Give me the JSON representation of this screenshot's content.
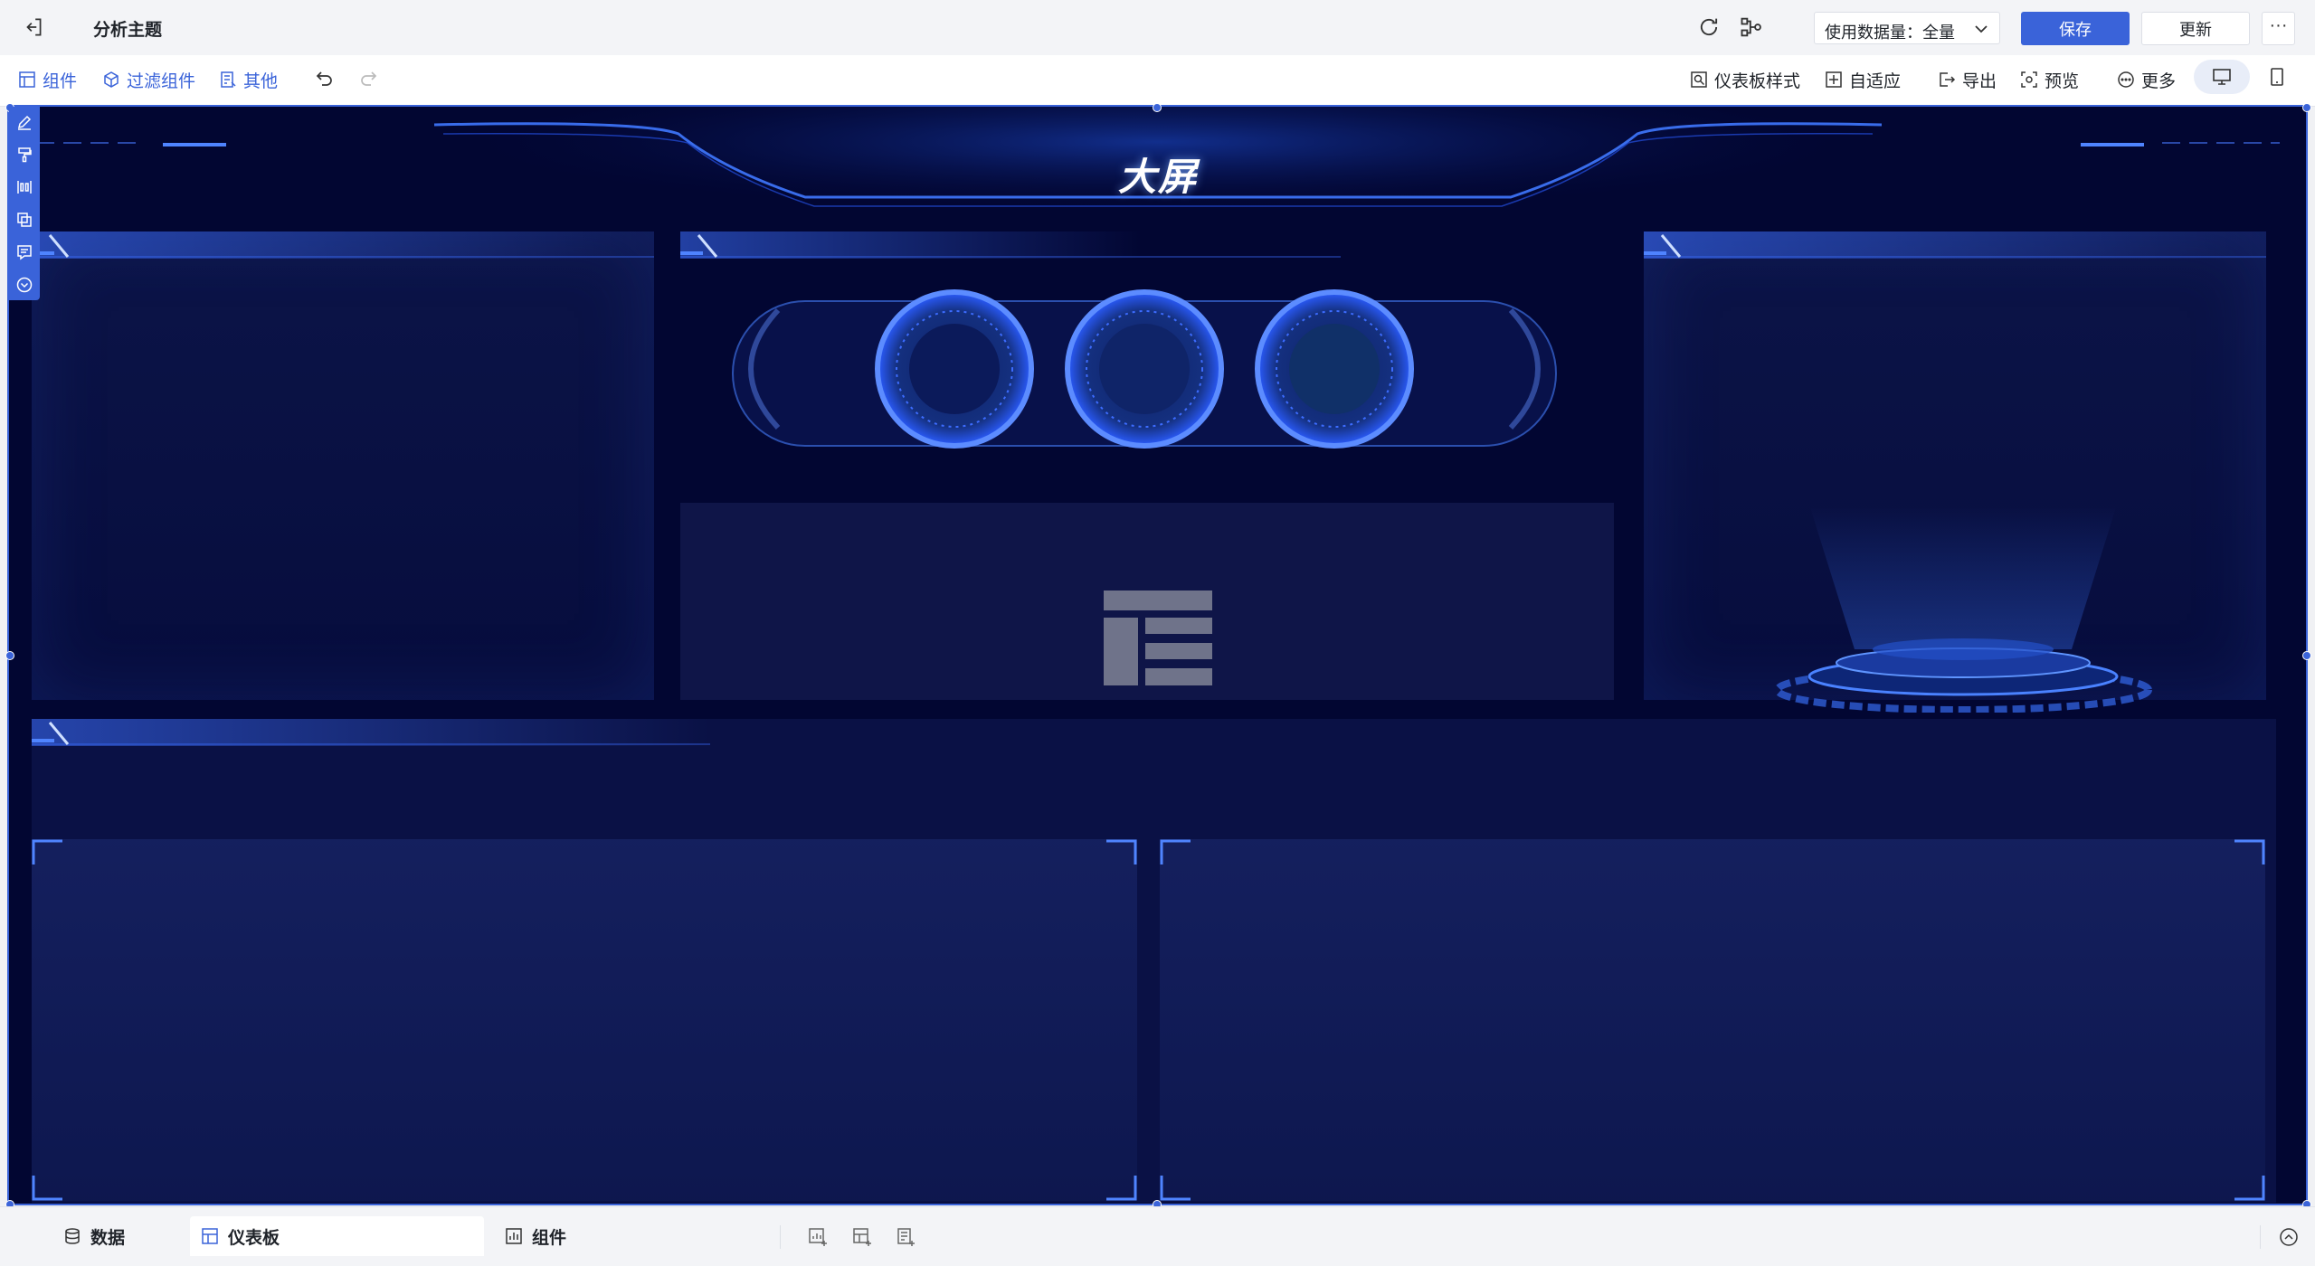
{
  "topbar": {
    "title": "分析主题",
    "data_select_label": "使用数据量：全量",
    "save_label": "保存",
    "update_label": "更新",
    "more_label": "···"
  },
  "toolbar": {
    "left": [
      {
        "label": "组件",
        "icon": "component-icon"
      },
      {
        "label": "过滤组件",
        "icon": "filter-icon"
      },
      {
        "label": "其他",
        "icon": "other-icon"
      }
    ],
    "right": [
      {
        "label": "仪表板样式",
        "icon": "style-icon"
      },
      {
        "label": "自适应",
        "icon": "adaptive-icon"
      },
      {
        "label": "导出",
        "icon": "export-icon"
      },
      {
        "label": "预览",
        "icon": "preview-icon"
      },
      {
        "label": "更多",
        "icon": "more-circle-icon"
      }
    ]
  },
  "canvas": {
    "title": "大屏"
  },
  "bottom_tabs": [
    {
      "label": "数据",
      "icon": "database-icon",
      "active": false
    },
    {
      "label": "仪表板",
      "icon": "dashboard-icon",
      "active": true
    },
    {
      "label": "组件",
      "icon": "chart-component-icon",
      "active": false
    }
  ],
  "colors": {
    "accent": "#3a63d9",
    "canvas_bg": "#020632",
    "panel_glow": "#2f6bff"
  }
}
